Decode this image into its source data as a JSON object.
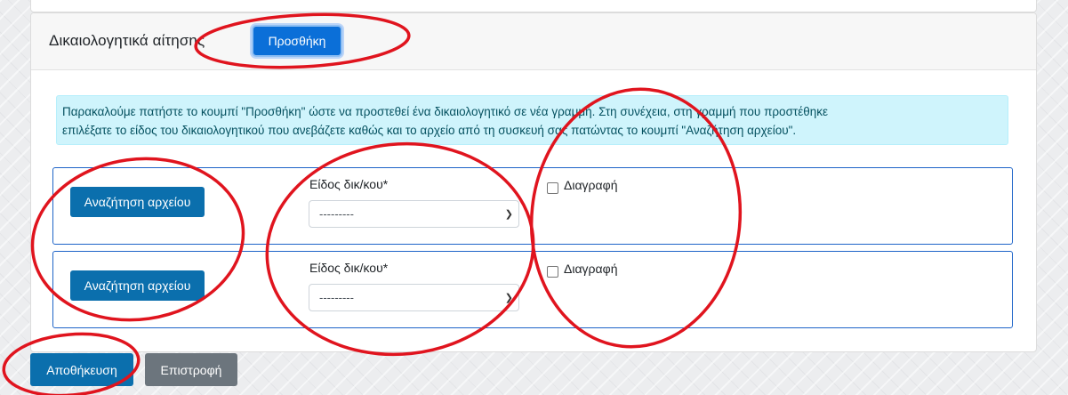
{
  "header": {
    "title": "Δικαιολογητικά αίτησης",
    "add_label": "Προσθήκη"
  },
  "info": {
    "line1": "Παρακαλούμε πατήστε το κουμπί \"Προσθήκη\" ώστε να προστεθεί ένα δικαιολογητικό σε νέα γραμμή. Στη συνέχεια, στη γραμμή που προστέθηκε",
    "line2": "επιλέξατε το είδος του δικαιολογητικού που ανεβάζετε καθώς και το αρχείο από τη συσκευή σας πατώντας το κουμπί \"Αναζήτηση αρχείου\"."
  },
  "rows": [
    {
      "search_label": "Αναζήτηση αρχείου",
      "type_label": "Είδος δικ/κου*",
      "select_value": "---------",
      "delete_label": "Διαγραφή"
    },
    {
      "search_label": "Αναζήτηση αρχείου",
      "type_label": "Είδος δικ/κου*",
      "select_value": "---------",
      "delete_label": "Διαγραφή"
    }
  ],
  "actions": {
    "save_label": "Αποθήκευση",
    "back_label": "Επιστροφή"
  },
  "colors": {
    "primary": "#0b6fad",
    "add_button": "#0b6fd8",
    "secondary": "#6c757d",
    "alert_bg": "#cff4fc",
    "annotation": "#e0141e"
  }
}
